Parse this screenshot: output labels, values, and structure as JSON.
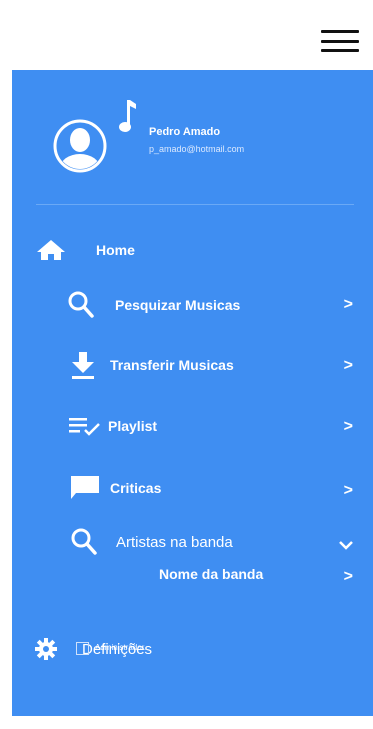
{
  "header": {
    "menu_icon": "hamburger-menu-icon"
  },
  "profile": {
    "name": "Pedro Amado",
    "email": "p_amado@hotmail.com",
    "avatar_icon": "user-avatar-icon",
    "note_icon": "music-note-icon"
  },
  "nav": {
    "home": {
      "label": "Home",
      "icon": "home-icon"
    },
    "search_music": {
      "label": "Pesquizar Musicas",
      "icon": "search-icon",
      "chevron": ">"
    },
    "transfer_music": {
      "label": "Transferir Musicas",
      "icon": "download-icon",
      "chevron": ">"
    },
    "playlist": {
      "label": "Playlist",
      "icon": "playlist-check-icon",
      "chevron": ">"
    },
    "reviews": {
      "label": "Criticas",
      "icon": "chat-bubble-icon",
      "chevron": ">"
    },
    "artists": {
      "label": "Artistas na banda",
      "icon": "search-icon",
      "chevron": "chevron-down"
    },
    "band_name": {
      "label": "Nome da banda",
      "chevron": ">"
    }
  },
  "settings": {
    "label": "Definições",
    "icon": "gear-icon",
    "admin_label": "Administrador.",
    "admin_checked": false
  },
  "colors": {
    "panel": "#3f8ef2",
    "text": "#ffffff",
    "header": "#ffffff"
  }
}
